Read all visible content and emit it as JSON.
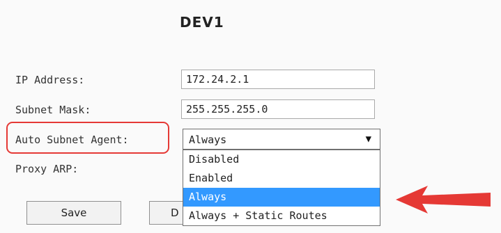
{
  "device": {
    "title": "DEV1"
  },
  "form": {
    "ip_label": "IP Address:",
    "ip_value": "172.24.2.1",
    "subnet_label": "Subnet Mask:",
    "subnet_value": "255.255.255.0",
    "agent_label": "Auto Subnet Agent:",
    "agent_value": "Always",
    "proxy_label": "Proxy ARP:"
  },
  "dropdown": {
    "options": [
      "Disabled",
      "Enabled",
      "Always",
      "Always + Static Routes"
    ],
    "selected": "Always"
  },
  "buttons": {
    "save": "Save",
    "second": "D"
  },
  "colors": {
    "highlight": "#3399ff",
    "annotation": "#e53935"
  }
}
